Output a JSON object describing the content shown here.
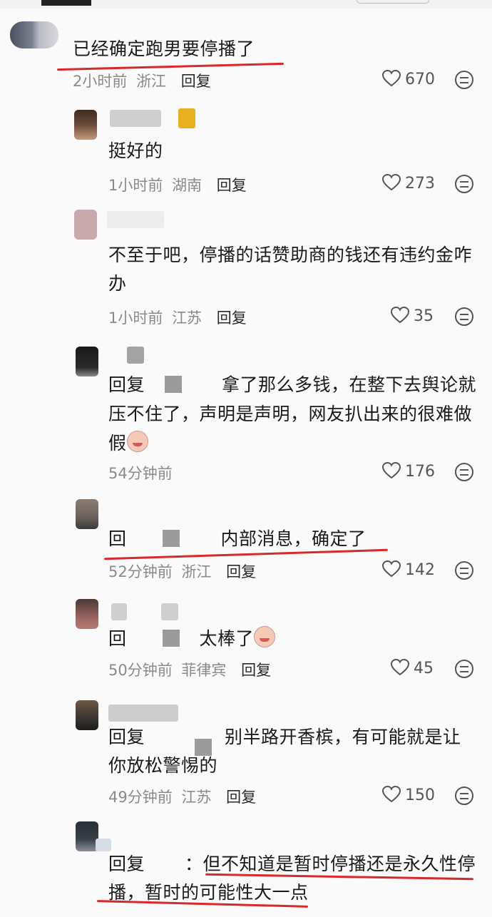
{
  "comments": [
    {
      "text": "已经确定跑男要停播了",
      "time": "2小时前",
      "region": "浙江",
      "reply": "回复",
      "likes": "670"
    },
    {
      "text": "挺好的",
      "time": "1小时前",
      "region": "湖南",
      "reply": "回复",
      "likes": "273"
    },
    {
      "line1": "不至于吧，停播的话赞助商的钱还有违约金咋",
      "line2": "办",
      "time": "1小时前",
      "region": "江苏",
      "reply": "回复",
      "likes": "35"
    },
    {
      "prefix": "回复",
      "line1": "拿了那么多钱，在整下去舆论就",
      "line2": "压不住了，声明是声明，网友扒出来的很难做",
      "line3": "假",
      "time": "54分钟前",
      "likes": "176"
    },
    {
      "prefix": "回",
      "text": "内部消息，确定了",
      "time": "52分钟前",
      "region": "浙江",
      "reply": "回复",
      "likes": "142"
    },
    {
      "prefix": "回",
      "text": "太棒了",
      "time": "50分钟前",
      "region": "菲律宾",
      "reply": "回复",
      "likes": "45"
    },
    {
      "prefix": "回复",
      "line1": "别半路开香槟，有可能就是让",
      "line2": "你放松警惕的",
      "time": "49分钟前",
      "region": "江苏",
      "reply": "回复",
      "likes": "150"
    },
    {
      "prefix": "回复",
      "line1": "：但不知道是暂时停播还是永久性停",
      "line2": "播，暂时的可能性大一点"
    }
  ],
  "colors": {
    "underline": "#d8282a",
    "meta": "#8a8a8a"
  },
  "icons": {
    "like": "heart-icon",
    "dislike": "neutral-face-icon"
  }
}
